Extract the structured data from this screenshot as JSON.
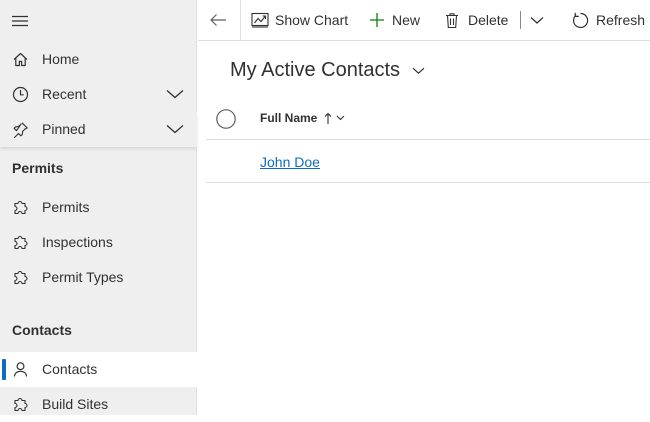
{
  "sidebar": {
    "items": [
      {
        "label": "Home",
        "icon": "home-icon"
      },
      {
        "label": "Recent",
        "icon": "clock-icon"
      },
      {
        "label": "Pinned",
        "icon": "pin-icon"
      }
    ],
    "sections": [
      {
        "title": "Permits",
        "items": [
          {
            "label": "Permits",
            "icon": "puzzle-icon"
          },
          {
            "label": "Inspections",
            "icon": "puzzle-icon"
          },
          {
            "label": "Permit Types",
            "icon": "puzzle-icon"
          }
        ]
      },
      {
        "title": "Contacts",
        "items": [
          {
            "label": "Contacts",
            "icon": "person-icon",
            "active": true
          },
          {
            "label": "Build Sites",
            "icon": "puzzle-icon"
          }
        ]
      }
    ]
  },
  "commandbar": {
    "show_chart": "Show Chart",
    "new": "New",
    "delete": "Delete",
    "refresh": "Refresh"
  },
  "view": {
    "title": "My Active Contacts"
  },
  "grid": {
    "columns": [
      {
        "label": "Full Name",
        "sort": "ascending"
      }
    ],
    "rows": [
      {
        "full_name": "John Doe"
      }
    ]
  },
  "colors": {
    "accent": "#0f6cbd",
    "sidebar_bg": "#efefef",
    "plus_green": "#107c10"
  }
}
